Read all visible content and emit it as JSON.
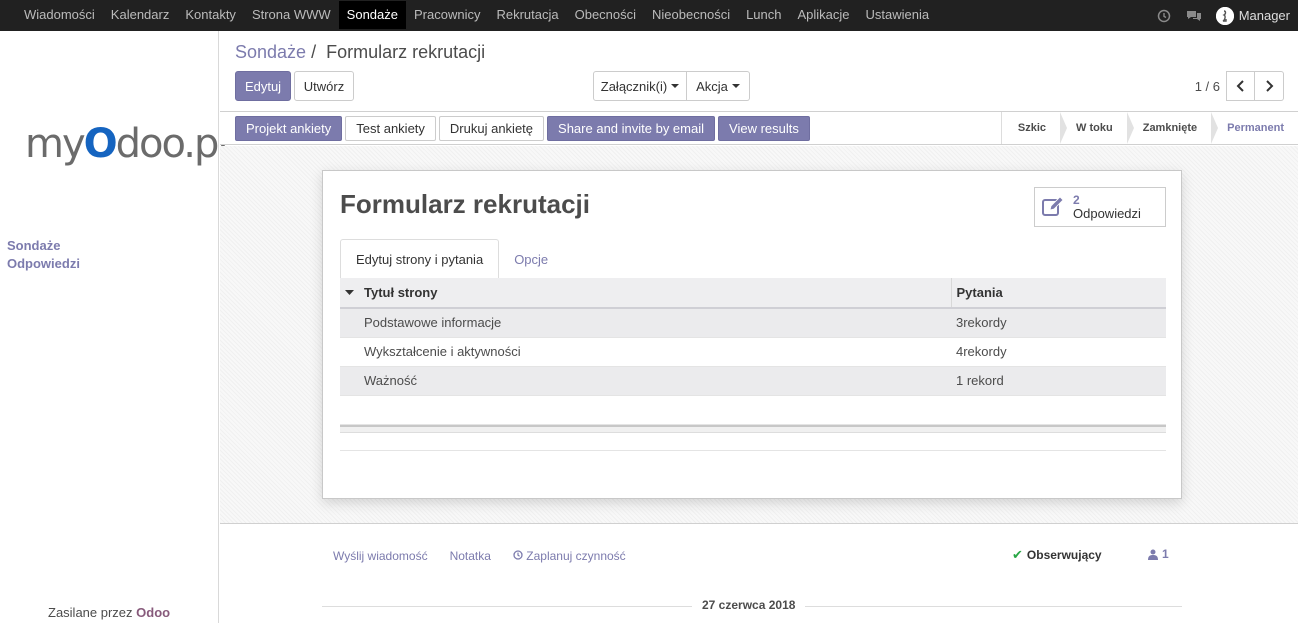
{
  "topbar": {
    "menu": [
      "Wiadomości",
      "Kalendarz",
      "Kontakty",
      "Strona WWW",
      "Sondaże",
      "Pracownicy",
      "Rekrutacja",
      "Obecności",
      "Nieobecności",
      "Lunch",
      "Aplikacje",
      "Ustawienia"
    ],
    "active_index": 4,
    "user_name": "Manager"
  },
  "sidebar": {
    "logo": {
      "prefix": "my",
      "o": "O",
      "suffix": "doo.pl"
    },
    "items": [
      {
        "label": "Sondaże"
      },
      {
        "label": "Odpowiedzi"
      }
    ],
    "powered_prefix": "Zasilane przez",
    "powered_brand": "Odoo"
  },
  "control_panel": {
    "breadcrumb_parent": "Sondaże",
    "breadcrumb_separator": "/",
    "breadcrumb_current": "Formularz rekrutacji",
    "edit_label": "Edytuj",
    "create_label": "Utwórz",
    "attachments_label": "Załącznik(i)",
    "action_label": "Akcja",
    "pager_value": "1 / 6"
  },
  "statusbar": {
    "buttons": [
      {
        "label": "Projekt ankiety",
        "primary": true
      },
      {
        "label": "Test ankiety",
        "primary": false
      },
      {
        "label": "Drukuj ankietę",
        "primary": false
      },
      {
        "label": "Share and invite by email",
        "primary": true
      },
      {
        "label": "View results",
        "primary": true
      }
    ],
    "states": [
      {
        "label": "Szkic",
        "current": false
      },
      {
        "label": "W toku",
        "current": false
      },
      {
        "label": "Zamknięte",
        "current": false
      },
      {
        "label": "Permanent",
        "current": true
      }
    ]
  },
  "form": {
    "title": "Formularz rekrutacji",
    "stat_count": "2",
    "stat_label": "Odpowiedzi",
    "tabs": [
      {
        "label": "Edytuj strony i pytania",
        "active": true
      },
      {
        "label": "Opcje",
        "active": false
      }
    ],
    "table": {
      "headers": [
        "Tytuł strony",
        "Pytania"
      ],
      "rows": [
        {
          "title": "Podstawowe informacje",
          "questions": "3rekordy"
        },
        {
          "title": "Wykształcenie i aktywności",
          "questions": "4rekordy"
        },
        {
          "title": "Ważność",
          "questions": "1 rekord"
        }
      ]
    }
  },
  "chatter": {
    "send_message": "Wyślij wiadomość",
    "log_note": "Notatka",
    "schedule_activity": "Zaplanuj czynność",
    "followers_label": "Obserwujący",
    "followers_count": "1",
    "date_separator": "27 czerwca 2018"
  },
  "colors": {
    "accent": "#7c7bad",
    "navbar": "#212121",
    "logo_o": "#1564c0"
  }
}
